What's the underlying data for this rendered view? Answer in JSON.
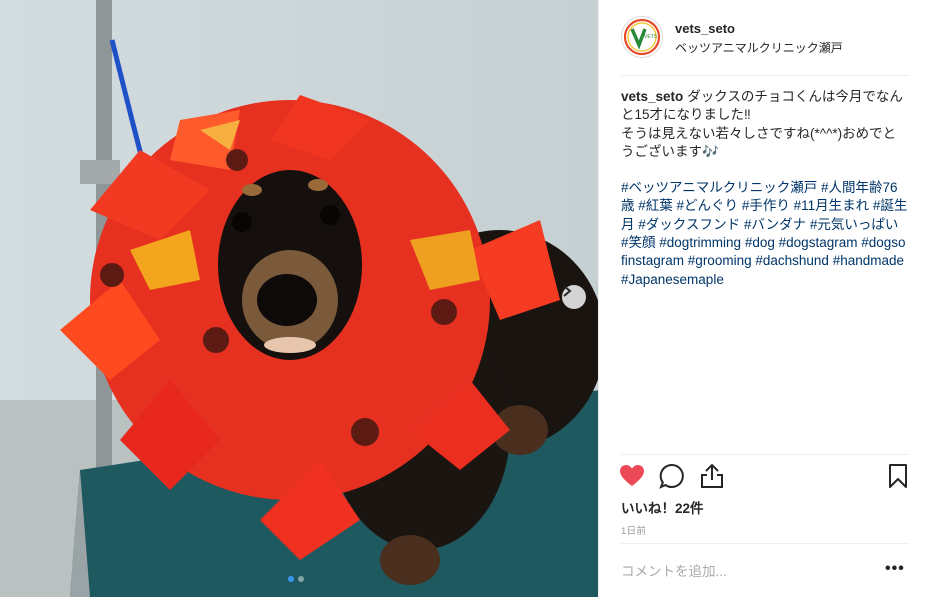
{
  "post": {
    "username": "vets_seto",
    "location": "ベッツアニマルクリニック瀬戸",
    "avatar_text": "VETS",
    "caption_lines": [
      "ダックスのチョコくんは今月でなんと15才になりました‼",
      "そうは見えない若々しさですね(*^^*)おめでとうございます"
    ],
    "caption_emoji": "🎶",
    "hashtags": [
      "#ベッツアニマルクリニック瀬戸",
      "#人間年齢76歳",
      "#紅葉",
      "#どんぐり",
      "#手作り",
      "#11月生まれ",
      "#誕生月",
      "#ダックスフンド",
      "#バンダナ",
      "#元気いっぱい",
      "#笑顔",
      "#dogtrimming",
      "#dog",
      "#dogstagram",
      "#dogsofinstagram",
      "#grooming",
      "#dachshund",
      "#handmade",
      "#Japanesemaple"
    ],
    "likes_label": "いいね！22件",
    "time_label": "1日前",
    "comment_placeholder": "コメントを追加...",
    "more_label": "•••"
  },
  "carousel": {
    "total": 2,
    "active": 1
  },
  "colors": {
    "heart": "#ed4956",
    "hashtag": "#003569",
    "dot_active": "#3897f0",
    "leaf": "#e8321e"
  },
  "icons": [
    "heart-icon",
    "comment-icon",
    "share-icon",
    "bookmark-icon",
    "chevron-right-icon"
  ]
}
